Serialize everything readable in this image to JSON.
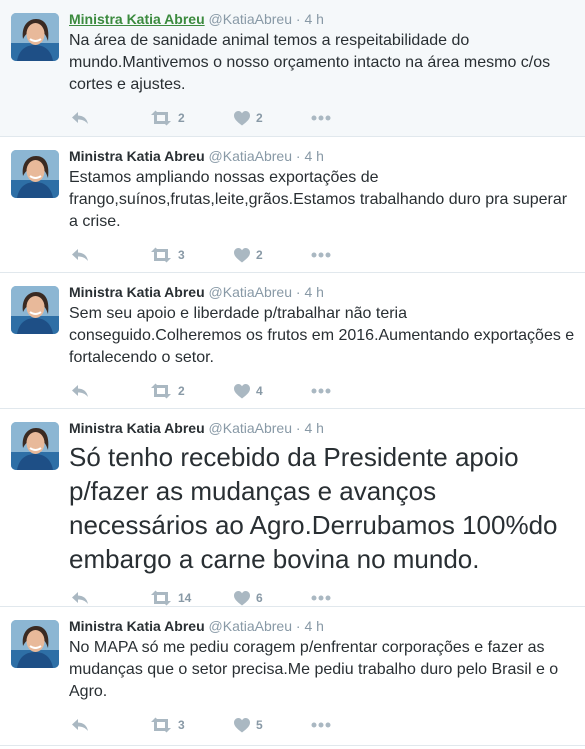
{
  "tweets": [
    {
      "name": "Ministra Katia Abreu",
      "handle": "@KatiaAbreu",
      "dot": "·",
      "time": "4 h",
      "text": "Na área de sanidade animal temos a respeitabilidade do mundo.Mantivemos o nosso orçamento intacto na área mesmo c/os cortes e ajustes.",
      "retweets": "2",
      "likes": "2"
    },
    {
      "name": "Ministra Katia Abreu",
      "handle": "@KatiaAbreu",
      "dot": "·",
      "time": "4 h",
      "text": "Estamos ampliando nossas exportações de frango,suínos,frutas,leite,grãos.Estamos trabalhando duro pra superar a crise.",
      "retweets": "3",
      "likes": "2"
    },
    {
      "name": "Ministra Katia Abreu",
      "handle": "@KatiaAbreu",
      "dot": "·",
      "time": "4 h",
      "text": "Sem seu apoio e liberdade p/trabalhar não teria conseguido.Colheremos os frutos em 2016.Aumentando exportações e fortalecendo o setor.",
      "retweets": "2",
      "likes": "4"
    },
    {
      "name": "Ministra Katia Abreu",
      "handle": "@KatiaAbreu",
      "dot": "·",
      "time": "4 h",
      "text": "Só tenho recebido da Presidente apoio p/fazer as mudanças e avanços necessários ao Agro.Derrubamos 100%do embargo a carne bovina no mundo.",
      "retweets": "14",
      "likes": "6"
    },
    {
      "name": "Ministra Katia Abreu",
      "handle": "@KatiaAbreu",
      "dot": "·",
      "time": "4 h",
      "text": "No MAPA só me pediu coragem p/enfrentar corporações e fazer as mudanças que o setor precisa.Me pediu trabalho duro pelo Brasil e o Agro.",
      "retweets": "3",
      "likes": "5"
    }
  ],
  "icons": {
    "reply": "reply-icon",
    "retweet": "retweet-icon",
    "like": "heart-icon",
    "more": "more-icon"
  },
  "colors": {
    "action_icon": "#aab8c2",
    "meta_text": "#8899a6",
    "highlight_bg": "#f5f8fa",
    "hovered_name": "#3b8a3e",
    "divider": "#e1e8ed"
  }
}
